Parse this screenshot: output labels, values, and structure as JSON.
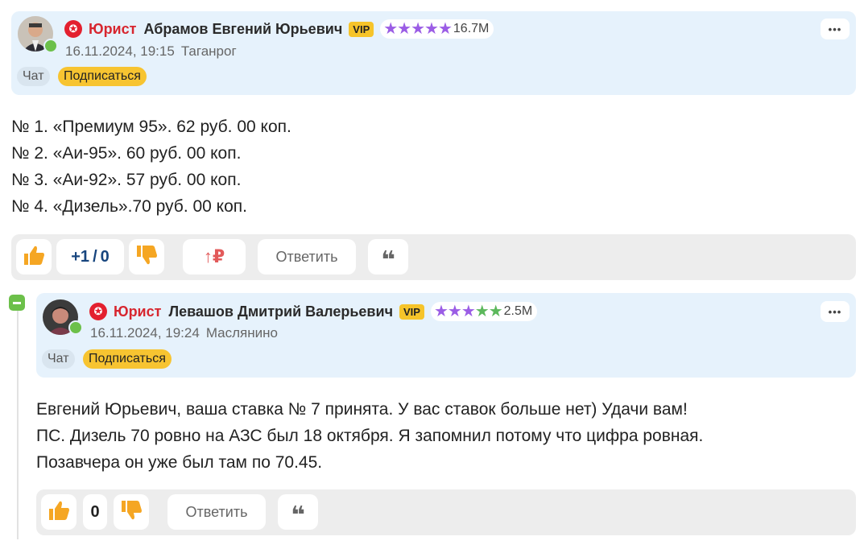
{
  "post1": {
    "author": {
      "role": "Юрист",
      "name": "Абрамов Евгений Юрьевич",
      "vip": "VIP",
      "stars": "★★★★★",
      "rating": "16.7M",
      "date": "16.11.2024, 19:15",
      "city": "Таганрог",
      "online": true
    },
    "chat_label": "Чат",
    "subscribe_label": "Подписаться",
    "more_label": "•••",
    "lines": [
      "№ 1. «Премиум 95». 62 руб. 00 коп.",
      "№ 2. «Аи-95». 60 руб. 00 коп.",
      "№ 3. «Аи-92». 57 руб. 00 коп.",
      "№ 4. «Дизель».70 руб. 00 коп."
    ],
    "actions": {
      "score_plus": "+1",
      "score_sep": "/",
      "score_minus": "0",
      "boost": "↑₽",
      "reply_label": "Ответить",
      "quote": "❝"
    }
  },
  "post2": {
    "author": {
      "role": "Юрист",
      "name": "Левашов Дмитрий Валерьевич",
      "vip": "VIP",
      "stars": "★★★★★",
      "rating": "2.5M",
      "date": "16.11.2024, 19:24",
      "city": "Маслянино",
      "online": true
    },
    "chat_label": "Чат",
    "subscribe_label": "Подписаться",
    "more_label": "•••",
    "lines": [
      "Евгений Юрьевич, ваша ставка № 7 принята. У вас ставок больше нет) Удачи вам!",
      "ПС. Дизель 70 ровно на АЗС был 18 октября. Я запомнил потому что цифра ровная.",
      "Позавчера он уже был там по 70.45."
    ],
    "actions": {
      "score": "0",
      "reply_label": "Ответить",
      "quote": "❝"
    }
  },
  "colors": {
    "header_bg": "#e6f2fc",
    "role_red": "#d7262f",
    "vip_yellow": "#f6c42a",
    "stars_purple": "#9b5de5",
    "stars_green": "#5cb85c",
    "thumb_orange": "#f5a623",
    "online_green": "#6cc04a"
  }
}
